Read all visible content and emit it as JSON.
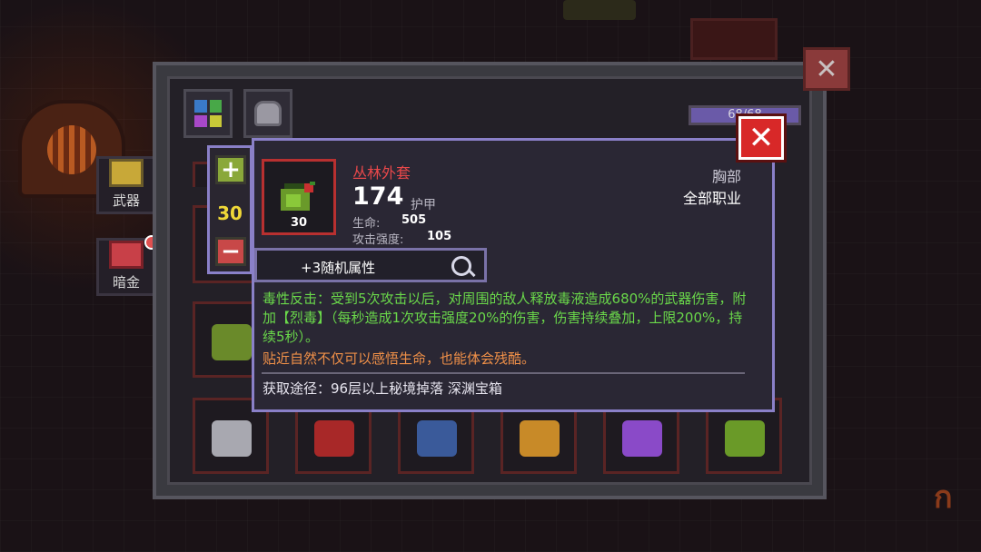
{
  "background": {
    "accent": "#8a3a1a"
  },
  "sidebar": {
    "weapon_label": "武器",
    "gold_label": "暗金"
  },
  "inventory": {
    "capacity_text": "68/68",
    "capacity_fraction": 1.0
  },
  "level_control": {
    "plus_symbol": "+",
    "level": "30",
    "minus_symbol": "−"
  },
  "item": {
    "name": "丛林外套",
    "name_color": "#e8484a",
    "level_badge": "30",
    "armor_value": "174",
    "armor_label": "护甲",
    "stats": [
      {
        "label": "生命:",
        "value": "505"
      },
      {
        "label": "攻击强度:",
        "value": "105"
      }
    ],
    "slot": "胸部",
    "class": "全部职业",
    "random_attributes": "+3随机属性",
    "effect_text": "毒性反击：受到5次攻击以后，对周围的敌人释放毒液造成680%的武器伤害，附加【烈毒】（每秒造成1次攻击强度20%的伤害，伤害持续叠加，上限200%，持续5秒）。",
    "flavor_text": "贴近自然不仅可以感悟生命，也能体会残酷。",
    "source_text": "获取途径：96层以上秘境掉落 深渊宝箱"
  },
  "close_symbol": "✕"
}
